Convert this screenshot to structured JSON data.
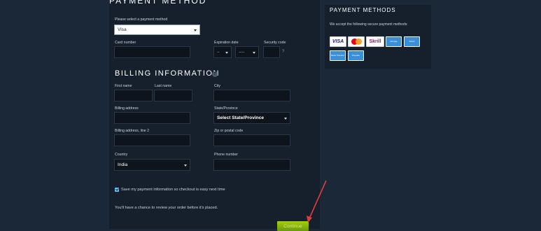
{
  "payment": {
    "title": "PAYMENT METHOD",
    "select_label": "Please select a payment method",
    "selected_method": "Visa",
    "card_number_label": "Card number",
    "expiration_label": "Expiration date",
    "exp_month": "--",
    "exp_year": "-----",
    "security_code_label": "Security code"
  },
  "billing": {
    "title": "BILLING INFORMATION",
    "help_glyph": "?",
    "first_name_label": "First name",
    "last_name_label": "Last name",
    "city_label": "City",
    "address_label": "Billing address",
    "state_label": "State/Province",
    "state_value": "Select State/Province",
    "address2_label": "Billing address, line 2",
    "zip_label": "Zip or postal code",
    "country_label": "Country",
    "country_value": "India",
    "phone_label": "Phone number"
  },
  "save_info_label": "Save my payment information so checkout is easy next time",
  "review_note": "You'll have a chance to review your order before it's placed.",
  "continue_label": "Continue",
  "side": {
    "title": "PAYMENT METHODS",
    "text": "We accept the following secure payment methods:",
    "methods": [
      "VISA",
      "mastercard",
      "Skrill",
      "Giropay",
      "Sofort",
      "Bank Transfer",
      "Paysafe"
    ]
  },
  "colors": {
    "background": "#1b2838",
    "panel": "#16202d",
    "accent_green": "#a4d007",
    "arrow": "#e03c3c"
  }
}
